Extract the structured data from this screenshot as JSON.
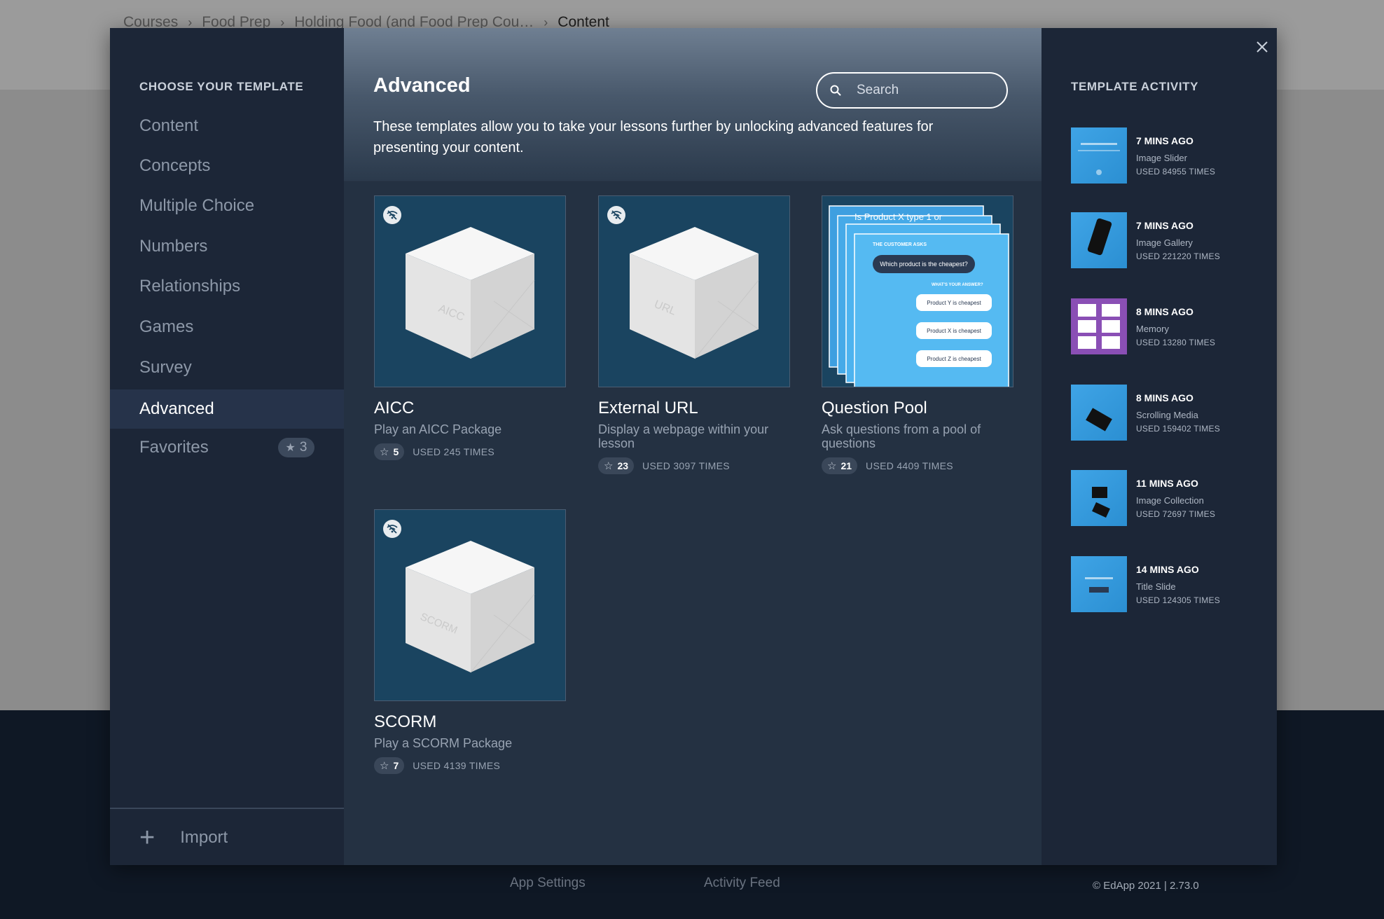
{
  "breadcrumb": {
    "items": [
      "Courses",
      "Food Prep",
      "Holding Food (and Food Prep Cou…",
      "Content"
    ],
    "separator": "›"
  },
  "footer": {
    "links": [
      "App Settings",
      "Activity Feed"
    ],
    "copyright": "© EdApp 2021 | 2.73.0"
  },
  "sidebar": {
    "title": "CHOOSE YOUR TEMPLATE",
    "items": [
      {
        "label": "Content"
      },
      {
        "label": "Concepts"
      },
      {
        "label": "Multiple Choice"
      },
      {
        "label": "Numbers"
      },
      {
        "label": "Relationships"
      },
      {
        "label": "Games"
      },
      {
        "label": "Survey"
      },
      {
        "label": "Advanced",
        "active": true
      },
      {
        "label": "Favorites",
        "badge": "3"
      }
    ],
    "import_label": "Import"
  },
  "main": {
    "title": "Advanced",
    "description": "These templates allow you to take your lessons further by unlocking advanced features for presenting your content.",
    "search": {
      "placeholder": "Search"
    },
    "cards": [
      {
        "name": "AICC",
        "description": "Play an AICC Package",
        "favorites": "5",
        "used": "USED 245 TIMES",
        "box_label": "AICC"
      },
      {
        "name": "External URL",
        "description": "Display a webpage within your lesson",
        "favorites": "23",
        "used": "USED 3097 TIMES",
        "box_label": "URL"
      },
      {
        "name": "Question Pool",
        "description": "Ask questions from a pool of questions",
        "favorites": "21",
        "used": "USED 4409 TIMES",
        "preview": {
          "header": "Is Product X type 1 or",
          "asks": "THE CUSTOMER ASKS",
          "question": "Which product is the cheapest?",
          "prompt": "WHAT'S YOUR ANSWER?",
          "answers": [
            "Product Y is cheapest",
            "Product X is cheapest",
            "Product Z is cheapest"
          ]
        }
      },
      {
        "name": "SCORM",
        "description": "Play a SCORM Package",
        "favorites": "7",
        "used": "USED 4139 TIMES",
        "box_label": "SCORM"
      }
    ]
  },
  "activity": {
    "title": "TEMPLATE ACTIVITY",
    "items": [
      {
        "time": "7 MINS AGO",
        "name": "Image Slider",
        "used": "USED 84955 TIMES"
      },
      {
        "time": "7 MINS AGO",
        "name": "Image Gallery",
        "used": "USED 221220 TIMES"
      },
      {
        "time": "8 MINS AGO",
        "name": "Memory",
        "used": "USED 13280 TIMES"
      },
      {
        "time": "8 MINS AGO",
        "name": "Scrolling Media",
        "used": "USED 159402 TIMES"
      },
      {
        "time": "11 MINS AGO",
        "name": "Image Collection",
        "used": "USED 72697 TIMES"
      },
      {
        "time": "14 MINS AGO",
        "name": "Title Slide",
        "used": "USED 124305 TIMES"
      }
    ]
  },
  "colors": {
    "sidebar_bg": "#1c2637",
    "main_bg": "#243142",
    "card_thumb_bg": "#1a4460",
    "accent_blue": "#3fa4e6",
    "memory_purple": "#8a4fb5"
  },
  "icons": {
    "close": "close-icon",
    "search": "search-icon",
    "star": "star-icon",
    "plus": "plus-icon",
    "offline": "offline-icon"
  }
}
